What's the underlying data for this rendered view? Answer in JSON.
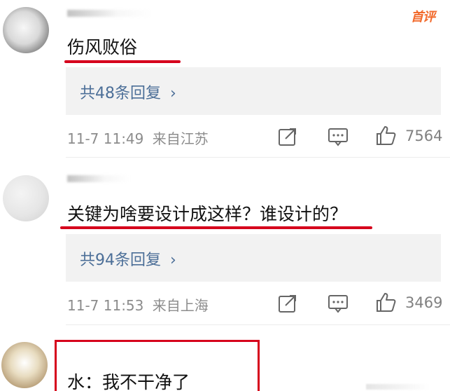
{
  "comments": [
    {
      "badge": "首评",
      "text": "伤风败俗",
      "replies_label": "共48条回复",
      "replies_chevron": "›",
      "time": "11-7 11:49",
      "location": "来自江苏",
      "likes": "7564",
      "underline_color": "#d6001c"
    },
    {
      "text": "关键为啥要设计成这样？谁设计的？",
      "replies_label": "共94条回复",
      "replies_chevron": "›",
      "time": "11-7 11:53",
      "location": "来自上海",
      "likes": "3469",
      "underline_color": "#d6001c"
    },
    {
      "text": "水：我不干净了",
      "box_color": "#d6001c"
    }
  ],
  "colors": {
    "link": "#4c6f98",
    "meta": "#8c8c8c",
    "badge": "#f26a2c",
    "reply_bg": "#f2f2f2"
  },
  "icons": {
    "share": "share-icon",
    "comment": "comment-icon",
    "like": "like-icon"
  }
}
